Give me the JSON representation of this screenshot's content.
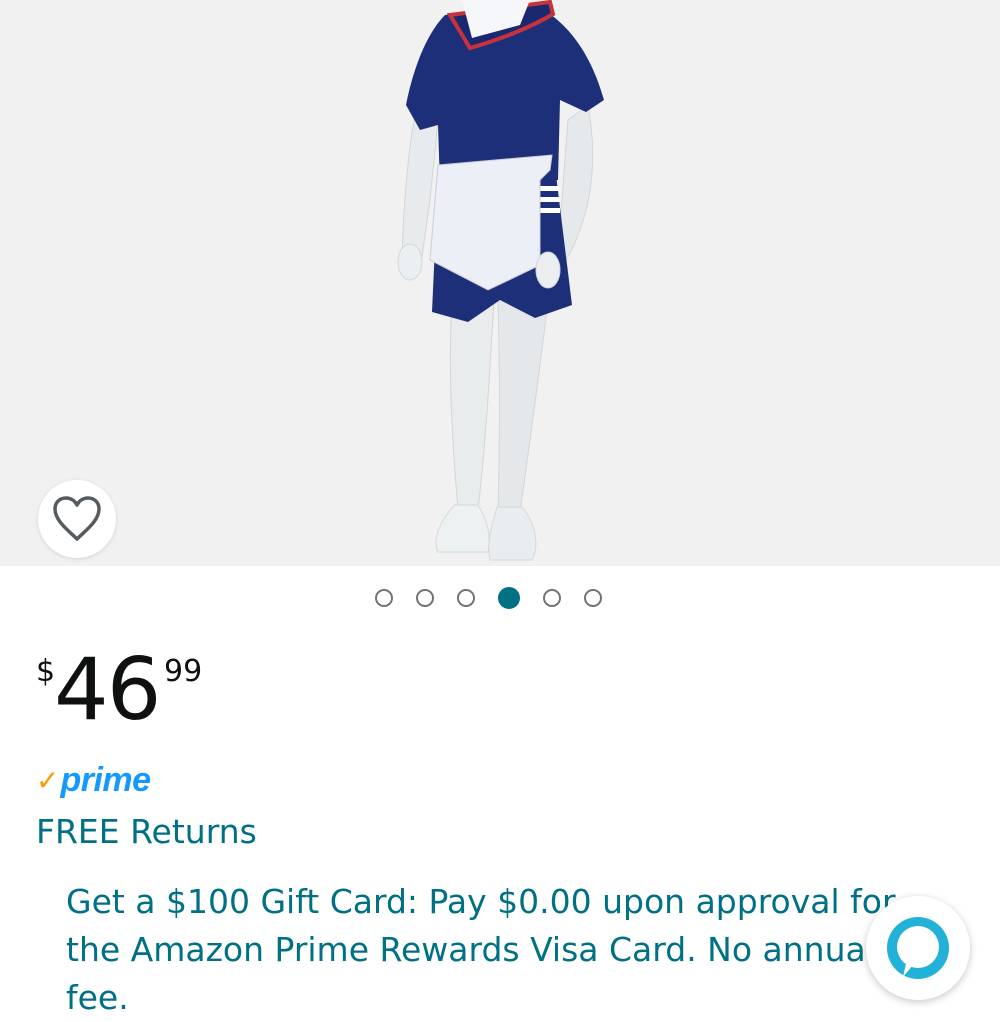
{
  "product": {
    "image_alt": "Child mannequin wearing navy sailor outfit with red-trimmed collar and white apron",
    "carousel": {
      "total": 6,
      "active_index": 3
    }
  },
  "price": {
    "currency_symbol": "$",
    "whole": "46",
    "fraction": "99"
  },
  "prime": {
    "check_glyph": "✓",
    "label": "prime"
  },
  "returns": {
    "label": "FREE Returns"
  },
  "promo": {
    "text": "Get a $100 Gift Card: Pay $0.00 upon approval for the Amazon Prime Rewards Visa Card. No annual fee."
  },
  "icons": {
    "wishlist": "heart-outline-icon",
    "assistant": "alexa-ring-icon"
  },
  "colors": {
    "link_teal": "#007185",
    "prime_blue": "#1399ff",
    "prime_check": "#ff9900",
    "image_background": "#f1f1f1"
  }
}
